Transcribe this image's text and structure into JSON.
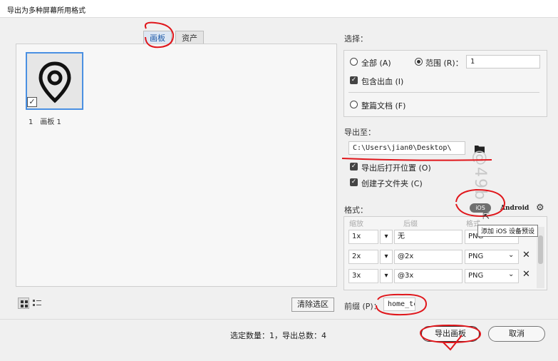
{
  "window": {
    "title": "导出为多种屏幕所用格式"
  },
  "tabs": [
    {
      "label": "画板",
      "active": true
    },
    {
      "label": "资产",
      "active": false
    }
  ],
  "artboards": [
    {
      "index": "1",
      "name": "画板 1",
      "checked": true,
      "icon": "location-pin-icon"
    }
  ],
  "view_toggle": {
    "grid_icon": "grid-view-icon",
    "list_icon": "list-view-icon"
  },
  "clear_selection_label": "清除选区",
  "select": {
    "label": "选择：",
    "all_label": "全部 (A)",
    "range_label": "范围 (R)：",
    "range_value": "1",
    "include_bleed_label": "包含出血 (I)",
    "whole_doc_label": "整篇文档 (F)"
  },
  "export_to": {
    "label": "导出至：",
    "path": "C:\\Users\\jian0\\Desktop\\",
    "folder_icon": "folder-icon",
    "open_after_label": "导出后打开位置 (O)",
    "create_subfolders_label": "创建子文件夹 (C)"
  },
  "formats": {
    "label": "格式：",
    "ios_label": "iOS",
    "android_label": "Android",
    "settings_icon": "gear-icon",
    "tooltip": "添加 iOS 设备预设",
    "headers": {
      "scale": "缩放",
      "suffix": "后缀",
      "format": "格式"
    },
    "rows": [
      {
        "scale": "1x",
        "suffix": "无",
        "format": "PNG"
      },
      {
        "scale": "2x",
        "suffix": "@2x",
        "format": "PNG"
      },
      {
        "scale": "3x",
        "suffix": "@3x",
        "format": "PNG"
      }
    ]
  },
  "prefix": {
    "label": "前缀 (P)：",
    "value": "home_tc"
  },
  "status": {
    "text": "选定数量：1，导出总数：4"
  },
  "buttons": {
    "export": "导出画板",
    "cancel": "取消"
  },
  "watermark": "@49b",
  "colors": {
    "accent": "#4a90e2",
    "annotation": "#e0161b"
  }
}
